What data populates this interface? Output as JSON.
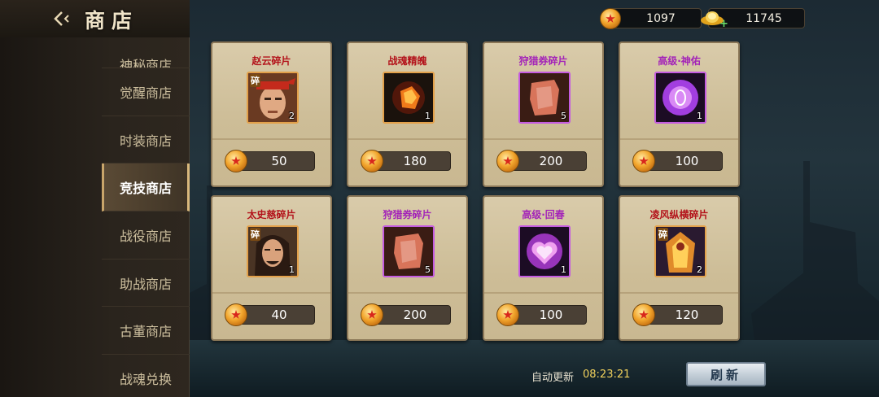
{
  "header": {
    "title": "商店"
  },
  "currency": {
    "coins": "1097",
    "ingots": "11745"
  },
  "menu": {
    "items": [
      {
        "label": "神秘商店"
      },
      {
        "label": "觉醒商店"
      },
      {
        "label": "时装商店"
      },
      {
        "label": "竞技商店"
      },
      {
        "label": "战役商店"
      },
      {
        "label": "助战商店"
      },
      {
        "label": "古董商店"
      },
      {
        "label": "战魂兑换"
      }
    ],
    "active": "竞技商店"
  },
  "shop_items": [
    {
      "name": "赵云碎片",
      "qty": "2",
      "price": "50",
      "shard_badge": "碎",
      "rarity": "orange"
    },
    {
      "name": "战魂精魄",
      "qty": "1",
      "price": "180",
      "rarity": "orange"
    },
    {
      "name": "狩猎券碎片",
      "qty": "5",
      "price": "200",
      "rarity": "purple"
    },
    {
      "name": "高级·神佑",
      "qty": "1",
      "price": "100",
      "rarity": "purple"
    },
    {
      "name": "太史慈碎片",
      "qty": "1",
      "price": "40",
      "shard_badge": "碎",
      "rarity": "orange"
    },
    {
      "name": "狩猎券碎片",
      "qty": "5",
      "price": "200",
      "rarity": "purple"
    },
    {
      "name": "高级·回春",
      "qty": "1",
      "price": "100",
      "rarity": "purple"
    },
    {
      "name": "凌风纵横碎片",
      "qty": "2",
      "price": "120",
      "shard_badge": "碎",
      "rarity": "orange"
    }
  ],
  "footer": {
    "auto_refresh_label": "自动更新",
    "auto_refresh_time": "08:23:21",
    "refresh_button": "刷新"
  },
  "icons": {
    "back": "back-arrow-icon",
    "coin": "coin-icon",
    "ingot": "gold-ingot-icon",
    "plus": "plus-icon"
  }
}
